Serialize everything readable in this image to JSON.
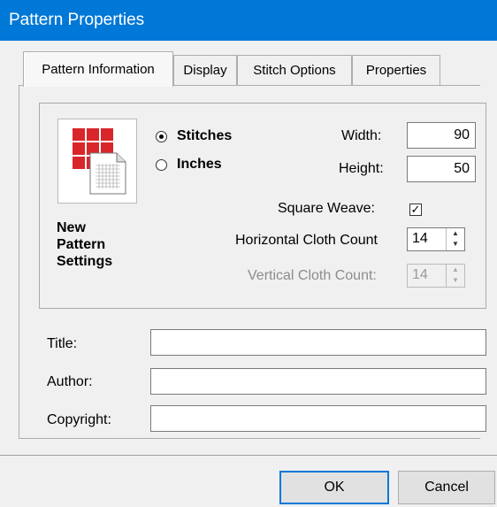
{
  "window": {
    "title": "Pattern Properties"
  },
  "tabs": [
    {
      "label": "Pattern Information",
      "active": true
    },
    {
      "label": "Display",
      "active": false
    },
    {
      "label": "Stitch Options",
      "active": false
    },
    {
      "label": "Properties",
      "active": false
    }
  ],
  "settings": {
    "group_label": "New Pattern Settings",
    "group_label_lines": [
      "New",
      "Pattern",
      "Settings"
    ],
    "unit_stitches_label": "Stitches",
    "unit_inches_label": "Inches",
    "unit_selected": "Stitches",
    "width_label": "Width:",
    "width_value": "90",
    "height_label": "Height:",
    "height_value": "50",
    "square_weave_label": "Square Weave:",
    "square_weave_checked": true,
    "horizontal_count_label": "Horizontal Cloth Count",
    "horizontal_count_value": "14",
    "vertical_count_label": "Vertical Cloth Count:",
    "vertical_count_value": "14"
  },
  "info": {
    "title_label": "Title:",
    "title_value": "",
    "author_label": "Author:",
    "author_value": "",
    "copyright_label": "Copyright:",
    "copyright_value": ""
  },
  "buttons": {
    "ok_label": "OK",
    "cancel_label": "Cancel"
  },
  "icons": {
    "pattern_icon": "new-pattern-icon",
    "accent": "#d9262b"
  }
}
